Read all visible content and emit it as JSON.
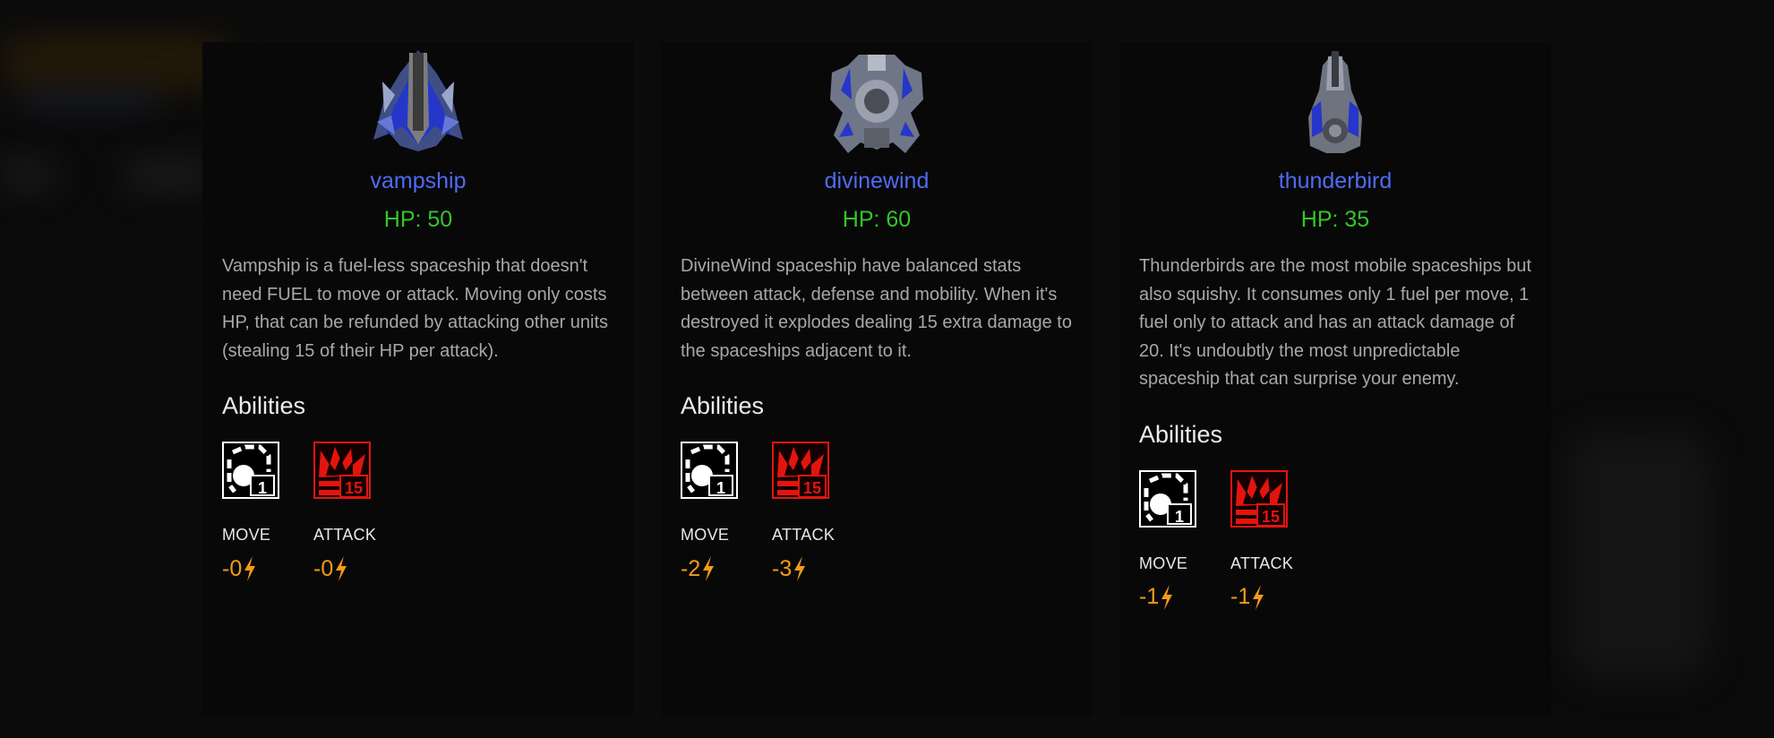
{
  "cards": [
    {
      "name": "vampship",
      "hp": "HP: 50",
      "description": "Vampship is a fuel-less spaceship that doesn't need FUEL to move or attack. Moving only costs HP, that can be refunded by attacking other units (stealing 15 of their HP per attack).",
      "abilities_title": "Abilities",
      "abilities": [
        {
          "label": "MOVE",
          "cost": "-0",
          "icon": "move-icon",
          "badge": "1"
        },
        {
          "label": "ATTACK",
          "cost": "-0",
          "icon": "attack-icon",
          "badge": "15"
        }
      ]
    },
    {
      "name": "divinewind",
      "hp": "HP: 60",
      "description": "DivineWind spaceship have balanced stats between attack, defense and mobility. When it's destroyed it explodes dealing 15 extra damage to the spaceships adjacent to it.",
      "abilities_title": "Abilities",
      "abilities": [
        {
          "label": "MOVE",
          "cost": "-2",
          "icon": "move-icon",
          "badge": "1"
        },
        {
          "label": "ATTACK",
          "cost": "-3",
          "icon": "attack-icon",
          "badge": "15"
        }
      ]
    },
    {
      "name": "thunderbird",
      "hp": "HP: 35",
      "description": "Thunderbirds are the most mobile spaceships but also squishy. It consumes only 1 fuel per move, 1 fuel only to attack and has an attack damage of 20. It's undoubtly the most unpredictable spaceship that can surprise your enemy.",
      "abilities_title": "Abilities",
      "abilities": [
        {
          "label": "MOVE",
          "cost": "-1",
          "icon": "move-icon",
          "badge": "1"
        },
        {
          "label": "ATTACK",
          "cost": "-1",
          "icon": "attack-icon",
          "badge": "15"
        }
      ]
    }
  ],
  "colors": {
    "name": "#4f6bf2",
    "hp": "#34c52c",
    "cost": "#f39a1a",
    "attack_icon": "#e3140f"
  }
}
